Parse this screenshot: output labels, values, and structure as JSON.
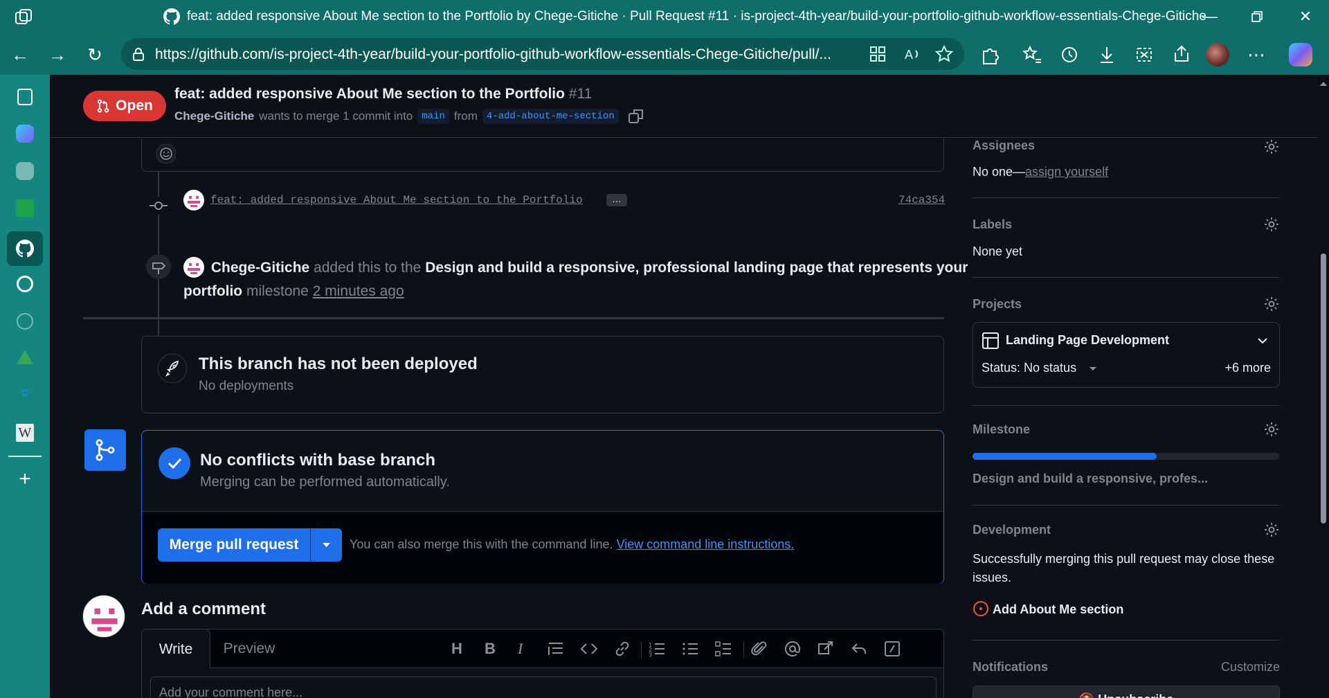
{
  "browser": {
    "window_title": "feat: added responsive About Me section to the Portfolio by Chege-Gitiche · Pull Request #11 · is-project-4th-year/build-your-portfolio-github-workflow-essentials-Chege-Gitiche",
    "url": "https://github.com/is-project-4th-year/build-your-portfolio-github-workflow-essentials-Chege-Gitiche/pull/..."
  },
  "header": {
    "state_label": "Open",
    "title": "feat: added responsive About Me section to the Portfolio",
    "number": "#11",
    "author": "Chege-Gitiche",
    "merge_text": "wants to merge 1 commit into",
    "base_branch": "main",
    "from_text": "from",
    "head_branch": "4-add-about-me-section"
  },
  "timeline": {
    "commit_message": "feat: added responsive About Me section to the Portfolio",
    "commit_more": "…",
    "commit_sha": "74ca354",
    "milestone_event": {
      "actor": "Chege-Gitiche",
      "text1": "added this to the",
      "milestone": "Design and build a responsive, professional landing page that represents your",
      "milestone_cont": "portfolio",
      "text2": "milestone",
      "time": "2 minutes ago"
    },
    "deploy": {
      "title": "This branch has not been deployed",
      "subtitle": "No deployments"
    },
    "merge": {
      "title": "No conflicts with base branch",
      "subtitle": "Merging can be performed automatically.",
      "button": "Merge pull request",
      "hint": "You can also merge this with the command line.",
      "link": "View command line instructions."
    },
    "comment": {
      "heading": "Add a comment",
      "tab_write": "Write",
      "tab_preview": "Preview",
      "placeholder": "Add your comment here..."
    }
  },
  "sidebar": {
    "assignees": {
      "title": "Assignees",
      "text": "No one—",
      "link": "assign yourself"
    },
    "labels": {
      "title": "Labels",
      "text": "None yet"
    },
    "projects": {
      "title": "Projects",
      "name": "Landing Page Development",
      "status": "Status: No status",
      "more": "+6 more"
    },
    "milestone": {
      "title": "Milestone",
      "name": "Design and build a responsive, profes...",
      "progress": 0.6
    },
    "development": {
      "title": "Development",
      "text": "Successfully merging this pull request may close these issues.",
      "issue": "Add About Me section"
    },
    "notifications": {
      "title": "Notifications",
      "customize": "Customize",
      "button": "Unsubscribe"
    }
  },
  "colors": {
    "accent": "#1f6feb",
    "open_red": "#da3633",
    "browser_teal": "#0f6e69"
  }
}
